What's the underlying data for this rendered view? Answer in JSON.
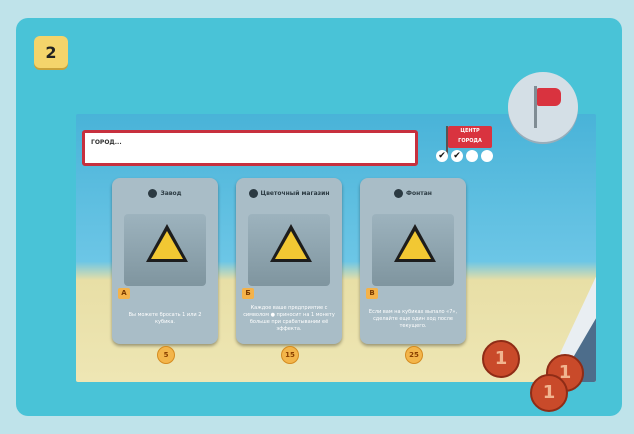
{
  "step": {
    "label": "2"
  },
  "board": {
    "city_name_label": "ГОРОД...",
    "center_flag_text": "ЦЕНТР ГОРОДА",
    "checkmarks": [
      "✔",
      "✔",
      "",
      ""
    ]
  },
  "cards": [
    {
      "title": "Завод",
      "letter": "А",
      "description": "Вы можете бросать 1 или 2 кубика.",
      "price": "5"
    },
    {
      "title": "Цветочный магазин",
      "letter": "Б",
      "description": "Каждое ваше предприятие с символом ● приносит на 1 монету больше при срабатывании её эффекта.",
      "price": "15"
    },
    {
      "title": "Фонтан",
      "letter": "В",
      "description": "Если вам на кубиках выпало «7», сделайте еще один ход после текущего.",
      "price": "25"
    }
  ],
  "coins": [
    "1",
    "1",
    "1"
  ],
  "colors": {
    "panel": "#49c3d7",
    "accent_red": "#c7303e",
    "step_badge": "#f4d46b"
  }
}
